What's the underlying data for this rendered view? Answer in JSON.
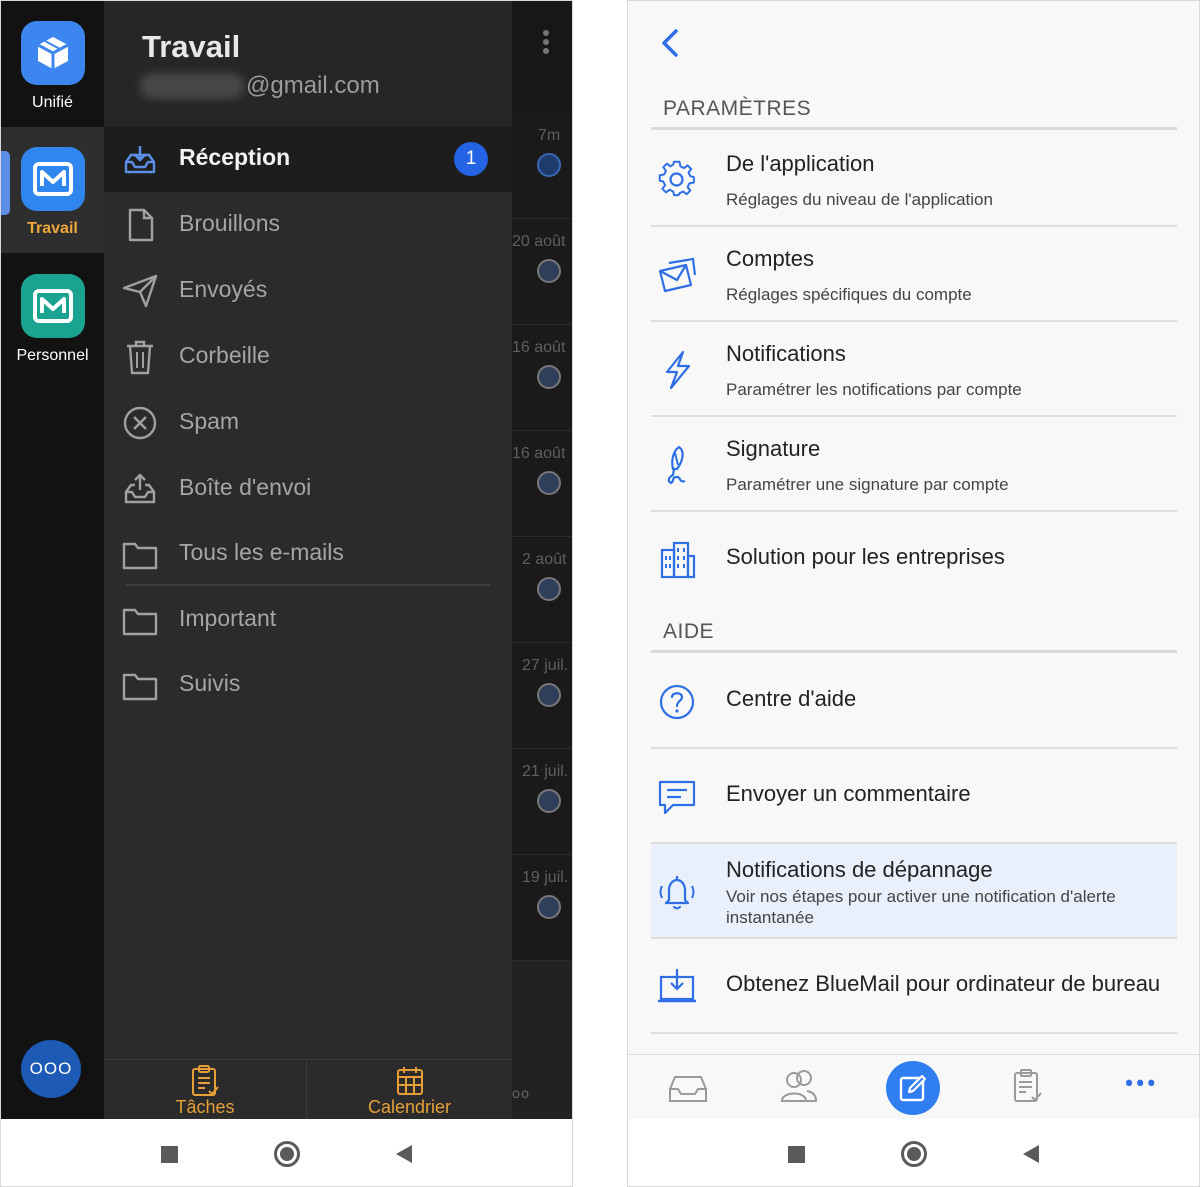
{
  "left": {
    "accounts": [
      {
        "label": "Unifié",
        "icon": "cube-icon",
        "color": "#3d86ef"
      },
      {
        "label": "Travail",
        "icon": "mail-icon",
        "color": "#2f86ee",
        "selected": true
      },
      {
        "label": "Personnel",
        "icon": "mail-icon",
        "color": "#1aa391"
      }
    ],
    "more_accounts_label": "OOO",
    "drawer": {
      "account_name": "Travail",
      "account_email": "@gmail.com",
      "folders": [
        {
          "label": "Réception",
          "icon": "inbox-icon",
          "badge": "1",
          "active": true
        },
        {
          "label": "Brouillons",
          "icon": "draft-icon"
        },
        {
          "label": "Envoyés",
          "icon": "send-icon"
        },
        {
          "label": "Corbeille",
          "icon": "trash-icon"
        },
        {
          "label": "Spam",
          "icon": "spam-icon"
        },
        {
          "label": "Boîte d'envoi",
          "icon": "outbox-icon"
        },
        {
          "label": "Tous les e-mails",
          "icon": "folder-icon"
        },
        {
          "label": "Important",
          "icon": "folder-icon"
        },
        {
          "label": "Suivis",
          "icon": "folder-icon"
        }
      ],
      "bottom": {
        "tasks_label": "Tâches",
        "calendar_label": "Calendrier"
      }
    },
    "list_peek_dates": [
      "7m",
      "20 août",
      "16 août",
      "16 août",
      "2 août",
      "27 juil.",
      "21 juil.",
      "19 juil."
    ]
  },
  "right": {
    "sections": [
      {
        "title": "PARAMÈTRES",
        "items": [
          {
            "title": "De l'application",
            "subtitle": "Réglages du niveau de l'application",
            "icon": "gear-icon"
          },
          {
            "title": "Comptes",
            "subtitle": "Réglages spécifiques du compte",
            "icon": "accounts-mail-icon"
          },
          {
            "title": "Notifications",
            "subtitle": "Paramétrer les notifications par compte",
            "icon": "lightning-icon"
          },
          {
            "title": "Signature",
            "subtitle": "Paramétrer une signature par compte",
            "icon": "signature-pen-icon"
          },
          {
            "title": "Solution pour les entreprises",
            "subtitle": "",
            "icon": "building-icon"
          }
        ]
      },
      {
        "title": "AIDE",
        "items": [
          {
            "title": "Centre d'aide",
            "subtitle": "",
            "icon": "help-circle-icon"
          },
          {
            "title": "Envoyer un commentaire",
            "subtitle": "",
            "icon": "feedback-icon"
          },
          {
            "title": "Notifications de dépannage",
            "subtitle": "Voir nos étapes pour activer une notification d'alerte instantanée",
            "icon": "bell-ring-icon",
            "highlighted": true
          },
          {
            "title": "Obtenez BlueMail pour ordinateur de bureau",
            "subtitle": "",
            "icon": "desktop-download-icon"
          }
        ]
      }
    ],
    "bottom_bar": [
      "inbox-tray-icon",
      "people-icon",
      "compose-icon",
      "tasks-icon",
      "more-dots-icon"
    ]
  },
  "colors": {
    "accent_blue": "#2f7ef2",
    "accent_orange": "#e6a037",
    "drawer_bg": "#2b2b2b"
  }
}
